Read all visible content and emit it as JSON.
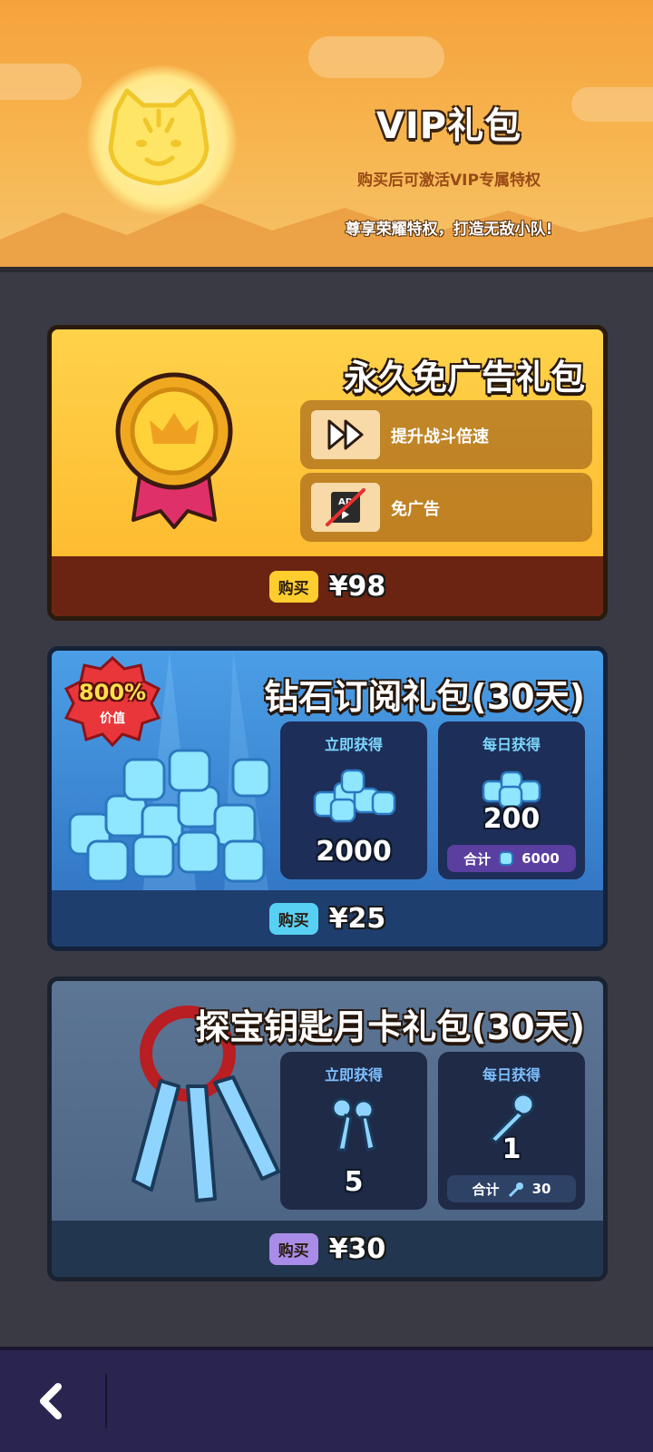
{
  "header": {
    "title": "VIP礼包",
    "subtitle": "购买后可激活VIP专属特权",
    "slogan": "尊享荣耀特权，打造无敌小队!"
  },
  "packs": [
    {
      "title": "永久免广告礼包",
      "features": [
        {
          "icon": "fast-forward-icon",
          "label": "提升战斗倍速"
        },
        {
          "icon": "no-ads-icon",
          "label": "免广告"
        }
      ],
      "buy_label": "购买",
      "price": "¥98"
    },
    {
      "title": "钻石订阅礼包(30天)",
      "badge_percent": "800%",
      "badge_label": "价值",
      "instant_label": "立即获得",
      "instant_amount": "2000",
      "daily_label": "每日获得",
      "daily_amount": "200",
      "total_label": "合计",
      "total_amount": "6000",
      "buy_label": "购买",
      "price": "¥25"
    },
    {
      "title": "探宝钥匙月卡礼包(30天)",
      "instant_label": "立即获得",
      "instant_amount": "5",
      "daily_label": "每日获得",
      "daily_amount": "1",
      "total_label": "合计",
      "total_amount": "30",
      "buy_label": "购买",
      "price": "¥30"
    }
  ],
  "colors": {
    "header_bg": "#f6a23c",
    "gold_card": "#fdb62a",
    "diamond_card": "#3a86d6",
    "key_card": "#546c8c",
    "bottom_bar": "#2a2450"
  },
  "nav": {
    "back_icon": "back-chevron-icon"
  }
}
